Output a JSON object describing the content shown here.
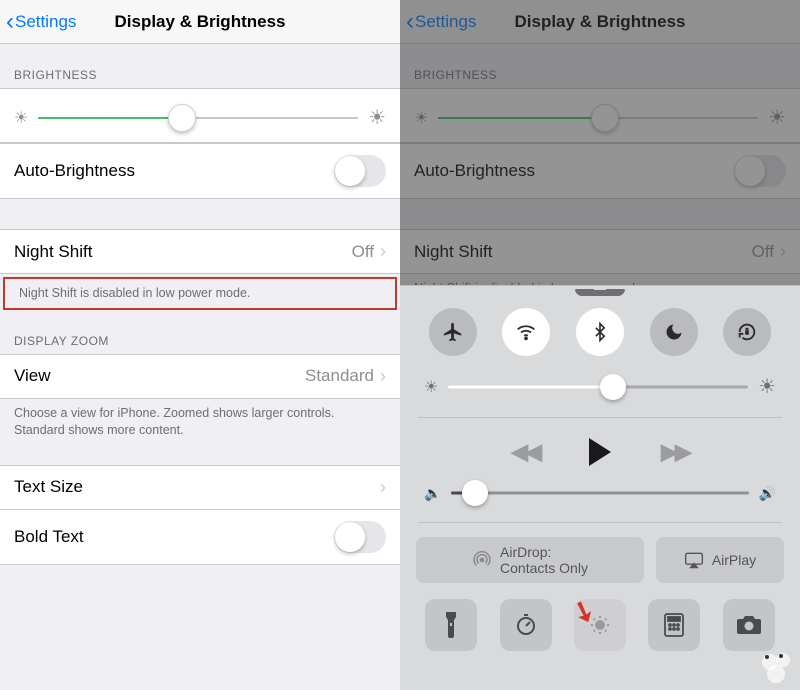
{
  "left": {
    "nav": {
      "back": "Settings",
      "title": "Display & Brightness"
    },
    "brightness_label": "BRIGHTNESS",
    "brightness_pct": 45,
    "auto_brightness": {
      "label": "Auto-Brightness",
      "on": false
    },
    "night_shift": {
      "label": "Night Shift",
      "value": "Off"
    },
    "night_shift_note": "Night Shift is disabled in low power mode.",
    "display_zoom_label": "DISPLAY ZOOM",
    "view": {
      "label": "View",
      "value": "Standard"
    },
    "view_note": "Choose a view for iPhone. Zoomed shows larger controls. Standard shows more content.",
    "text_size": {
      "label": "Text Size"
    },
    "bold_text": {
      "label": "Bold Text",
      "on": false
    }
  },
  "right": {
    "nav": {
      "back": "Settings",
      "title": "Display & Brightness"
    },
    "brightness_label": "BRIGHTNESS",
    "brightness_pct": 52,
    "auto_brightness": {
      "label": "Auto-Brightness",
      "on": false
    },
    "night_shift": {
      "label": "Night Shift",
      "value": "Off"
    },
    "night_shift_note": "Night Shift is disabled in low power mode."
  },
  "cc": {
    "toggles": [
      {
        "name": "airplane",
        "on": false
      },
      {
        "name": "wifi",
        "on": true
      },
      {
        "name": "bluetooth",
        "on": true
      },
      {
        "name": "dnd",
        "on": false
      },
      {
        "name": "rotation-lock",
        "on": false
      }
    ],
    "brightness_pct": 55,
    "media": {
      "state": "paused"
    },
    "volume_pct": 8,
    "airdrop": {
      "title": "AirDrop:",
      "subtitle": "Contacts Only"
    },
    "airplay": "AirPlay",
    "bottom": [
      "flashlight",
      "timer",
      "night-shift",
      "calculator",
      "camera"
    ]
  }
}
